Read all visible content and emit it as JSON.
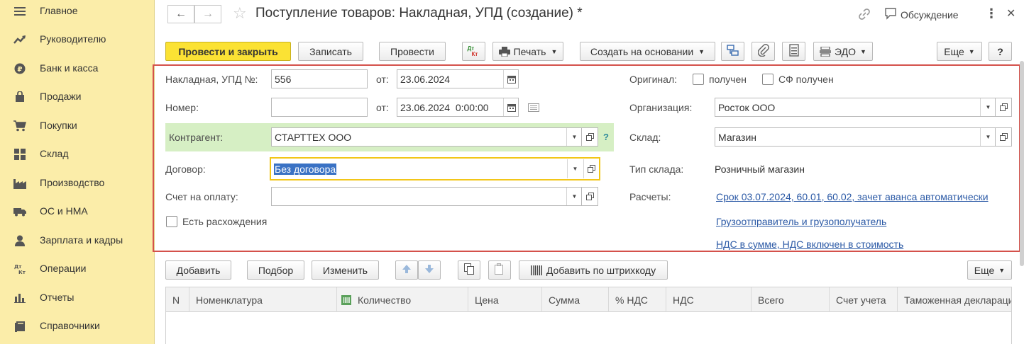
{
  "sidebar": {
    "items": [
      {
        "label": "Главное",
        "icon": "menu-icon"
      },
      {
        "label": "Руководителю",
        "icon": "trend-icon"
      },
      {
        "label": "Банк и касса",
        "icon": "ruble-coin-icon"
      },
      {
        "label": "Продажи",
        "icon": "shopping-bag-icon"
      },
      {
        "label": "Покупки",
        "icon": "cart-icon"
      },
      {
        "label": "Склад",
        "icon": "warehouse-icon"
      },
      {
        "label": "Производство",
        "icon": "factory-icon"
      },
      {
        "label": "ОС и НМА",
        "icon": "truck-icon"
      },
      {
        "label": "Зарплата и кадры",
        "icon": "person-icon"
      },
      {
        "label": "Операции",
        "icon": "dt-kt-icon"
      },
      {
        "label": "Отчеты",
        "icon": "bar-chart-icon"
      },
      {
        "label": "Справочники",
        "icon": "book-icon"
      }
    ]
  },
  "header": {
    "title": "Поступление товаров: Накладная, УПД (создание) *",
    "discussion_label": "Обсуждение",
    "more_symbol": "⋮",
    "close_symbol": "✕",
    "back_symbol": "←",
    "forward_symbol": "→",
    "star_symbol": "☆"
  },
  "toolbar": {
    "post_close": "Провести и закрыть",
    "save": "Записать",
    "post": "Провести",
    "print": "Печать",
    "create_based": "Создать на основании",
    "edo": "ЭДО",
    "more": "Еще",
    "help": "?",
    "dtkt_top": "Дт",
    "dtkt_bottom": "Кт"
  },
  "form": {
    "invoice_label": "Накладная, УПД №:",
    "invoice_number": "556",
    "from_label": "от:",
    "invoice_date": "23.06.2024",
    "number_label": "Номер:",
    "number_value": "",
    "from_label2": "от:",
    "number_date": "23.06.2024  0:00:00",
    "counterparty_label": "Контрагент:",
    "counterparty_value": "СТАРТТЕХ ООО",
    "counterparty_help": "?",
    "contract_label": "Договор:",
    "contract_value": "Без договора",
    "payment_account_label": "Счет на оплату:",
    "payment_account_value": "",
    "discrepancy_label": "Есть расхождения",
    "original_label": "Оригинал:",
    "received_label": "получен",
    "sf_received_label": "СФ получен",
    "organization_label": "Организация:",
    "organization_value": "Росток ООО",
    "warehouse_label": "Склад:",
    "warehouse_value": "Магазин",
    "warehouse_type_label": "Тип склада:",
    "warehouse_type_value": "Розничный магазин",
    "settlements_label": "Расчеты:",
    "settlements_link": "Срок 03.07.2024, 60.01, 60.02, зачет аванса автоматически",
    "consignor_link": "Грузоотправитель и грузополучатель",
    "vat_link": "НДС в сумме, НДС включен в стоимость"
  },
  "table_toolbar": {
    "add": "Добавить",
    "pick": "Подбор",
    "edit": "Изменить",
    "barcode": "Добавить по штрихкоду",
    "more": "Еще"
  },
  "table": {
    "columns": [
      "N",
      "Номенклатура",
      "Количество",
      "Цена",
      "Сумма",
      "% НДС",
      "НДС",
      "Всего",
      "Счет учета",
      "Таможенная декларация"
    ]
  },
  "colors": {
    "sidebar_bg": "#fbeda9",
    "primary_button": "#fbe234",
    "highlight_frame": "#d4514b",
    "counterparty_bg": "#d6efc4",
    "link": "#2c5aa6",
    "selection": "#3a72c4"
  }
}
